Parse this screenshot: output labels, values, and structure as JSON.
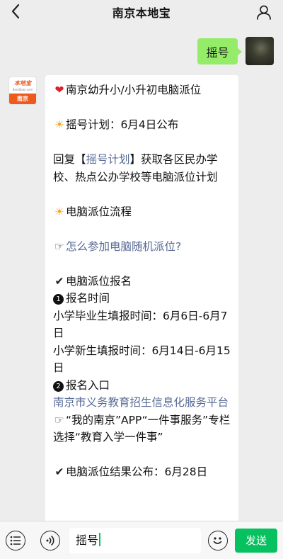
{
  "header": {
    "title": "南京本地宝",
    "back_icon": "chevron-left-icon",
    "profile_icon": "user-icon"
  },
  "outgoing_message": {
    "text": "摇号"
  },
  "bot_avatar": {
    "brand_text": "本地宝",
    "brand_sub": "Bendibao.com",
    "city_text": "南京",
    "accent_color": "#ec5b1c"
  },
  "incoming_message": {
    "title_line": "南京幼升小/小升初电脑派位",
    "plan_line": "摇号计划：6月4日公布",
    "reply_line_prefix": "回复【",
    "reply_link": "摇号计划",
    "reply_line_suffix": "】获取各区民办学校、热点公办学校等电脑派位计划",
    "process_heading": "电脑派位流程",
    "faq_link": "怎么参加电脑随机派位?",
    "signup_heading": "电脑派位报名",
    "item1_num": "1",
    "item1_label": "报名时间",
    "grad_time": "小学毕业生填报时间：6月6日-6月7日",
    "new_time": "小学新生填报时间：6月14日-6月15日",
    "item2_num": "2",
    "item2_label": "报名入口",
    "portal_link": "南京市义务教育招生信息化服务平台",
    "app_line": "“我的南京”APP“一件事服务”专栏选择“教育入学一件事”",
    "result_line": "电脑派位结果公布：6月28日"
  },
  "composer": {
    "input_value": "摇号",
    "send_label": "发送",
    "send_color": "#07c160"
  }
}
